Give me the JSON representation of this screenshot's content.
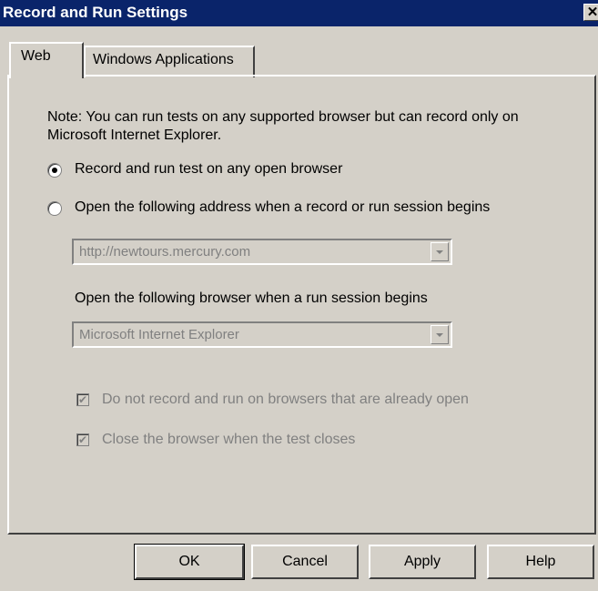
{
  "window": {
    "title": "Record and Run Settings",
    "close_glyph": "✕"
  },
  "tabs": [
    {
      "label": "Web",
      "active": true
    },
    {
      "label": "Windows Applications",
      "active": false
    }
  ],
  "web": {
    "note": "Note: You can run tests on any supported browser but can record only on Microsoft Internet Explorer.",
    "radio_options": [
      {
        "label": "Record and run test on any open browser",
        "checked": true
      },
      {
        "label": "Open the following address when a record or run session begins",
        "checked": false
      }
    ],
    "address_combo": {
      "value": "http://newtours.mercury.com",
      "enabled": false
    },
    "browser_label": "Open the following browser when a run session begins",
    "browser_combo": {
      "value": "Microsoft Internet Explorer",
      "enabled": false
    },
    "checkboxes": [
      {
        "label": "Do not record and run on browsers that are already open",
        "checked": true,
        "enabled": false
      },
      {
        "label": "Close the browser when the test closes",
        "checked": true,
        "enabled": false
      }
    ],
    "check_glyph": "✔"
  },
  "buttons": {
    "ok": "OK",
    "cancel": "Cancel",
    "apply": "Apply",
    "help": "Help"
  }
}
